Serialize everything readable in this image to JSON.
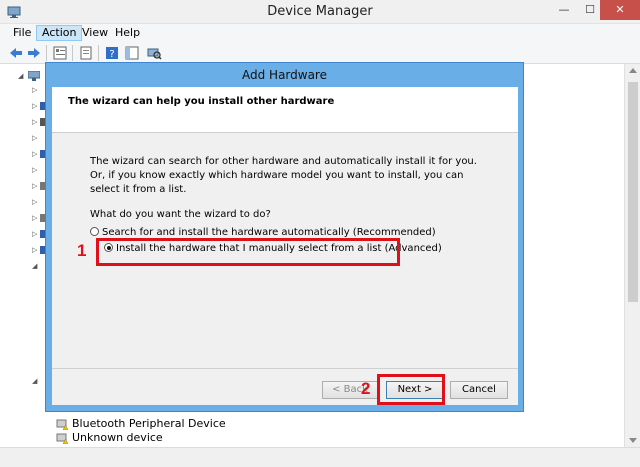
{
  "window": {
    "title": "Device Manager",
    "controls": {
      "minimize": "—",
      "maximize": "☐",
      "close": "✕"
    }
  },
  "menubar": {
    "items": [
      {
        "label": "File"
      },
      {
        "label": "Action"
      },
      {
        "label": "View"
      },
      {
        "label": "Help"
      }
    ]
  },
  "tree": {
    "visible_items": [
      {
        "label": "Bluetooth Peripheral Device"
      },
      {
        "label": "Unknown device"
      }
    ]
  },
  "dialog": {
    "title": "Add Hardware",
    "heading": "The wizard can help you install other hardware",
    "description": "The wizard can search for other hardware and automatically install it for you. Or, if you know exactly which hardware model you want to install, you can select it from a list.",
    "question": "What do you want the wizard to do?",
    "options": [
      {
        "label": "Search for and install the hardware automatically (Recommended)",
        "selected": false
      },
      {
        "label": "Install the hardware that I manually select from a list (Advanced)",
        "selected": true
      }
    ],
    "buttons": {
      "back": "< Back",
      "next": "Next >",
      "cancel": "Cancel"
    }
  },
  "annotations": {
    "step1": "1",
    "step2": "2",
    "color": "#e0101a"
  },
  "colors": {
    "dialog_frame": "#6aaee8",
    "close_button": "#c7504a",
    "menu_active": "#cde6f7"
  }
}
